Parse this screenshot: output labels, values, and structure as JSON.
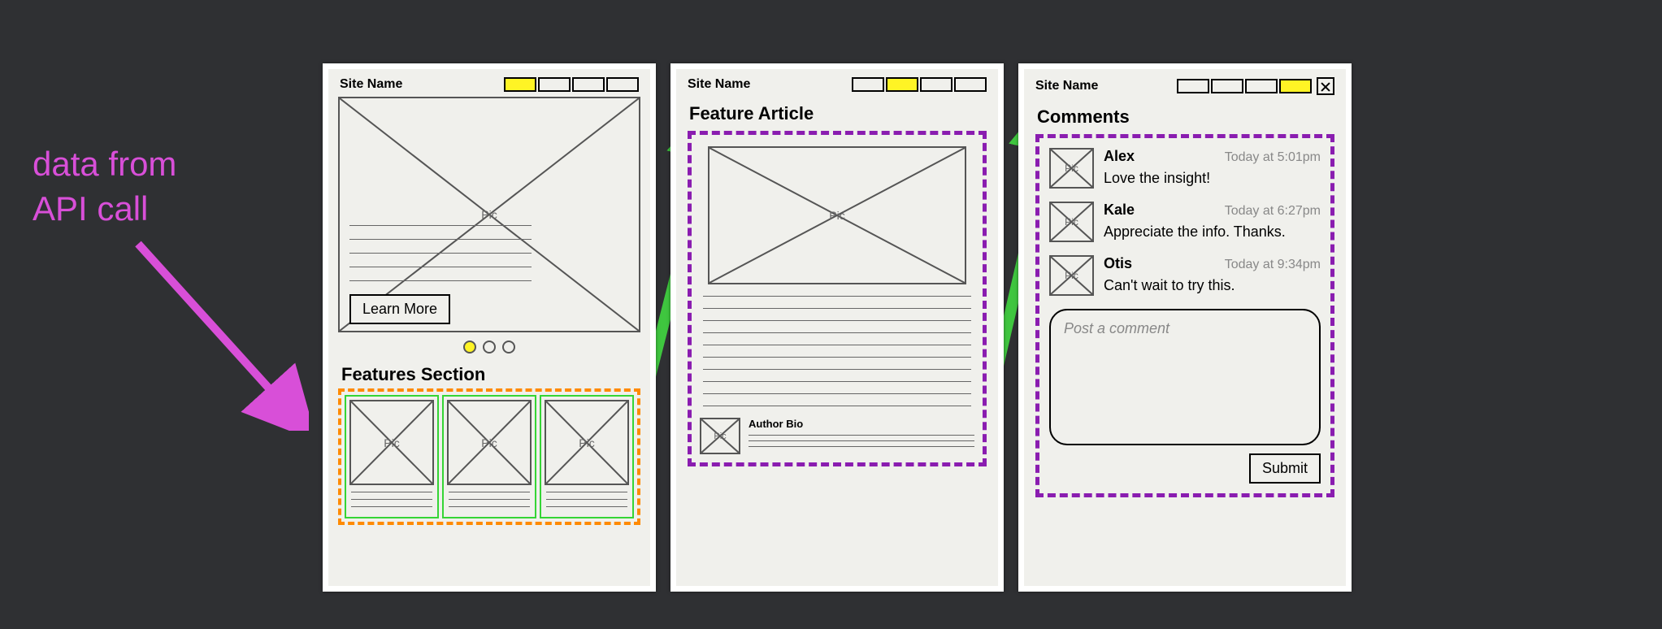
{
  "annotation": {
    "label": "data from\nAPI call"
  },
  "colors": {
    "annotation_magenta": "#d84fd8",
    "nav_arrow_green": "#3fc63f",
    "dashed_orange": "#ff8a00",
    "dashed_purple": "#8a1db0",
    "feature_card_border_green": "#35d535",
    "active_tab_yellow": "#fff425"
  },
  "screens": {
    "home": {
      "site_name": "Site Name",
      "nav_tabs": [
        true,
        false,
        false,
        false
      ],
      "hero_image_label": "Pic",
      "hero_cta": "Learn More",
      "pager_index": 0,
      "pager_count": 3,
      "features_title": "Features Section",
      "feature_cards": [
        {
          "image_label": "Pic"
        },
        {
          "image_label": "Pic"
        },
        {
          "image_label": "Pic"
        }
      ]
    },
    "article": {
      "site_name": "Site Name",
      "nav_tabs": [
        false,
        true,
        false,
        false
      ],
      "title": "Feature Article",
      "image_label": "Pic",
      "author_image_label": "Pic",
      "author_label": "Author Bio"
    },
    "comments": {
      "site_name": "Site Name",
      "nav_tabs": [
        false,
        false,
        false,
        true
      ],
      "title": "Comments",
      "items": [
        {
          "avatar_label": "Pic",
          "name": "Alex",
          "time": "Today at 5:01pm",
          "body": "Love the insight!"
        },
        {
          "avatar_label": "Pic",
          "name": "Kale",
          "time": "Today at 6:27pm",
          "body": "Appreciate the info. Thanks."
        },
        {
          "avatar_label": "Pic",
          "name": "Otis",
          "time": "Today at 9:34pm",
          "body": "Can't wait to try this."
        }
      ],
      "compose_placeholder": "Post a comment",
      "submit_label": "Submit"
    }
  }
}
